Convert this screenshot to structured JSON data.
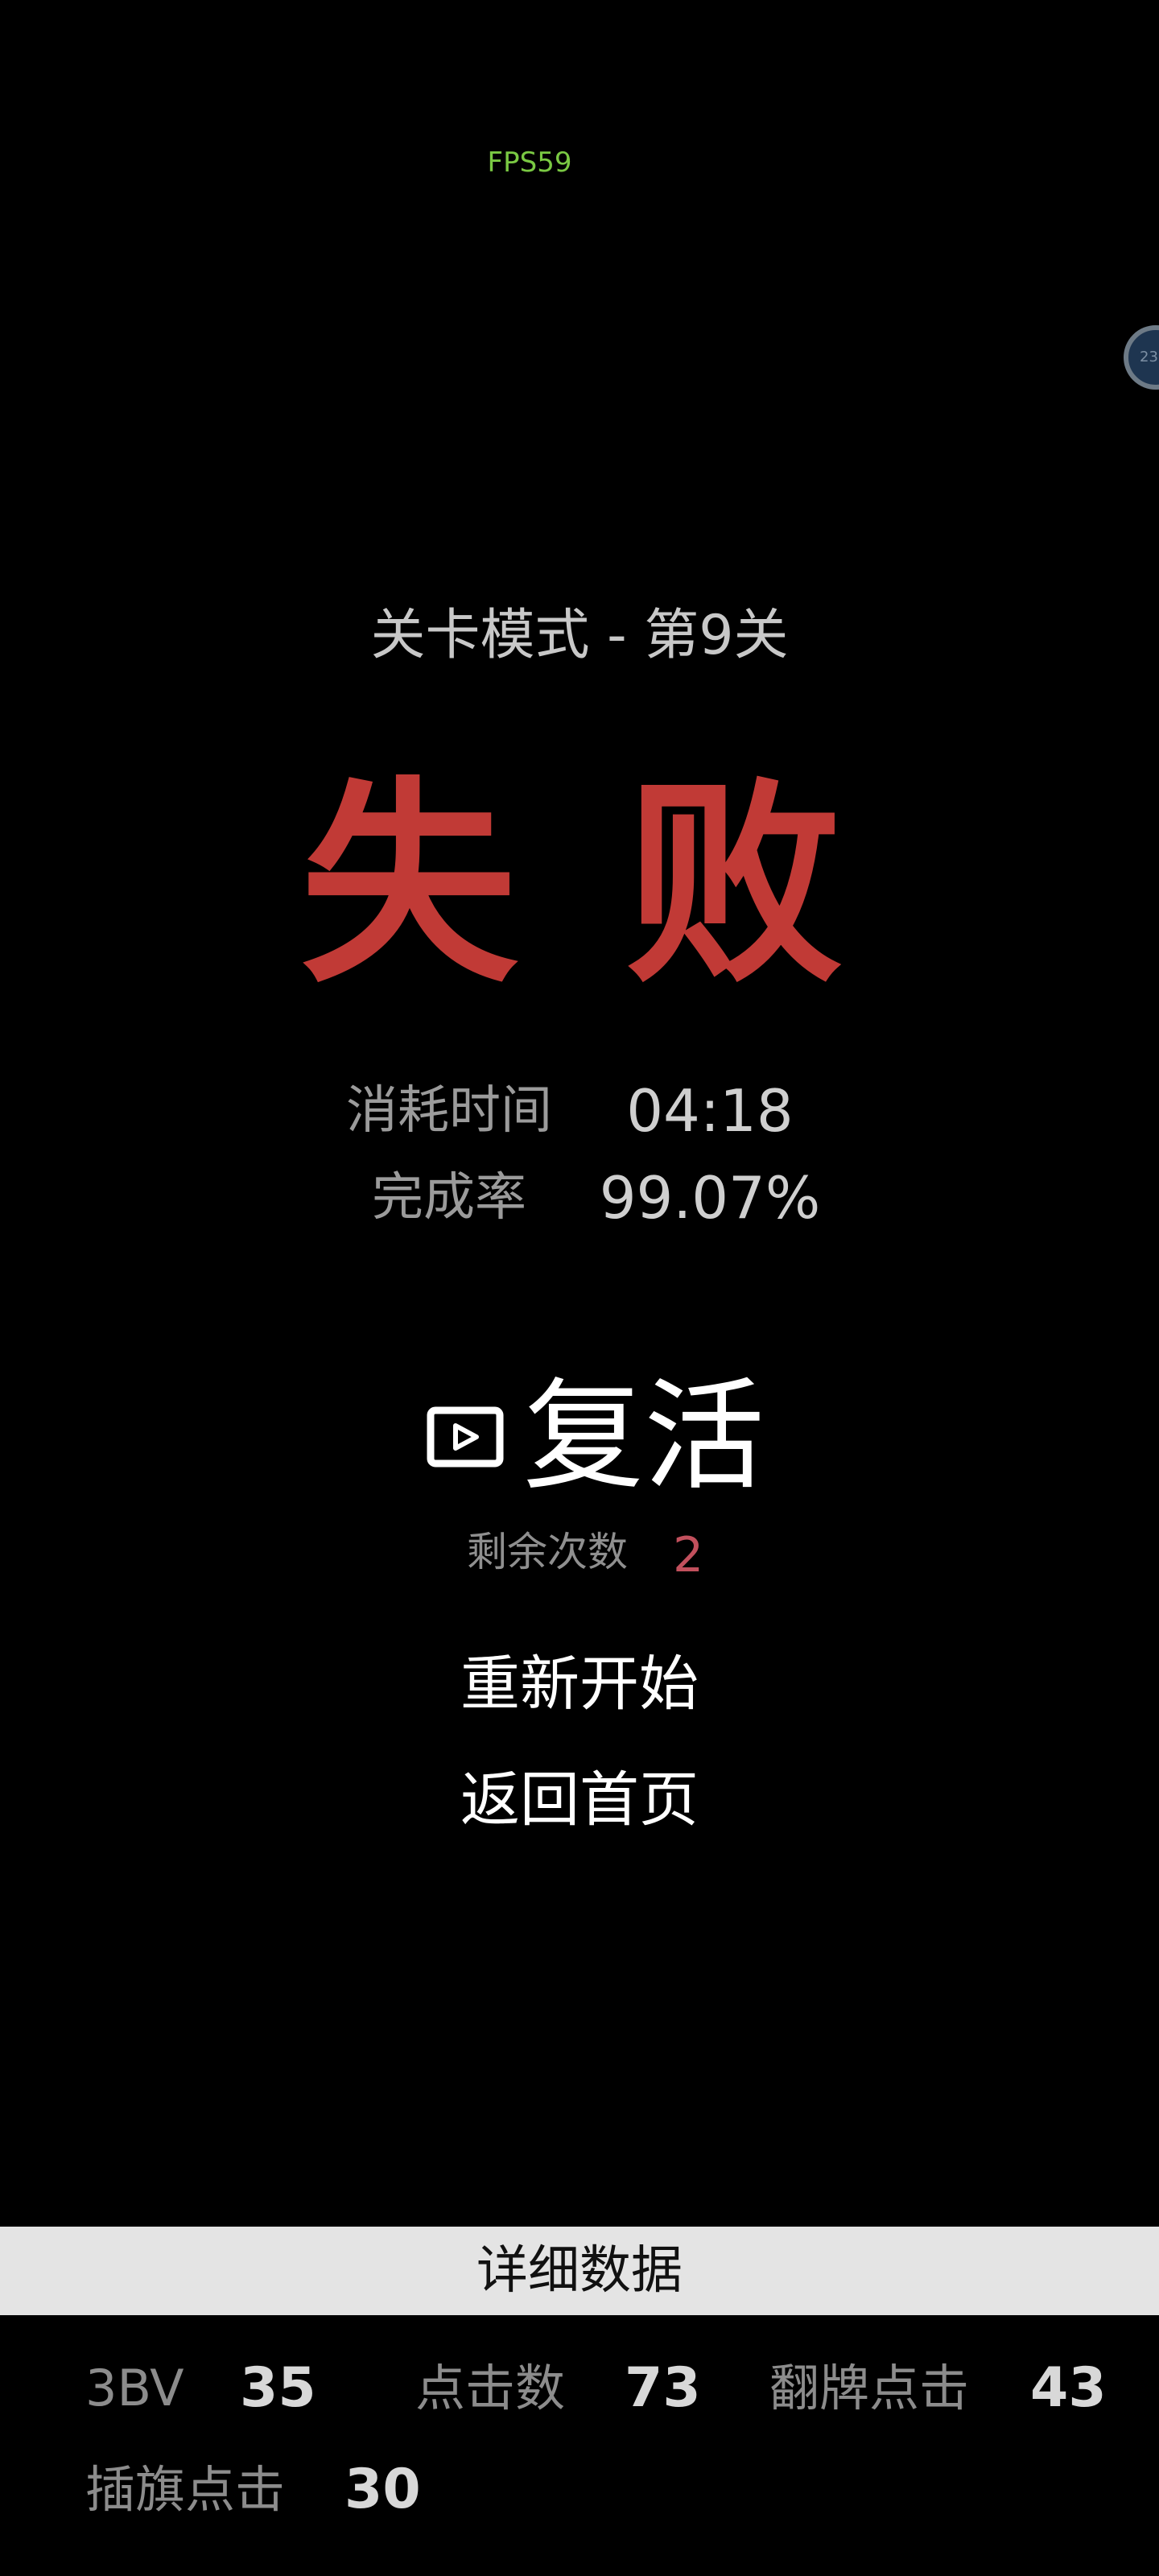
{
  "overlay": {
    "fps": "FPS59",
    "floating_ball_text": "23"
  },
  "header": {
    "mode_title": "关卡模式 - 第9关",
    "result_title": "失 败"
  },
  "stats": {
    "time_label": "消耗时间",
    "time_value": "04:18",
    "completion_label": "完成率",
    "completion_value": "99.07%"
  },
  "actions": {
    "revive_icon": "video-play-icon",
    "revive_label": "复活",
    "remaining_label": "剩余次数",
    "remaining_count": "2",
    "restart_label": "重新开始",
    "home_label": "返回首页"
  },
  "details": {
    "title": "详细数据",
    "items": [
      {
        "label": "3BV",
        "value": "35"
      },
      {
        "label": "点击数",
        "value": "73"
      },
      {
        "label": "翻牌点击",
        "value": "43"
      },
      {
        "label": "插旗点击",
        "value": "30"
      }
    ]
  },
  "colors": {
    "background": "#000000",
    "fail_red": "#c13a36",
    "count_red": "#c2505d",
    "fps_green": "#7ac943",
    "details_bar": "#e4e4e4"
  }
}
